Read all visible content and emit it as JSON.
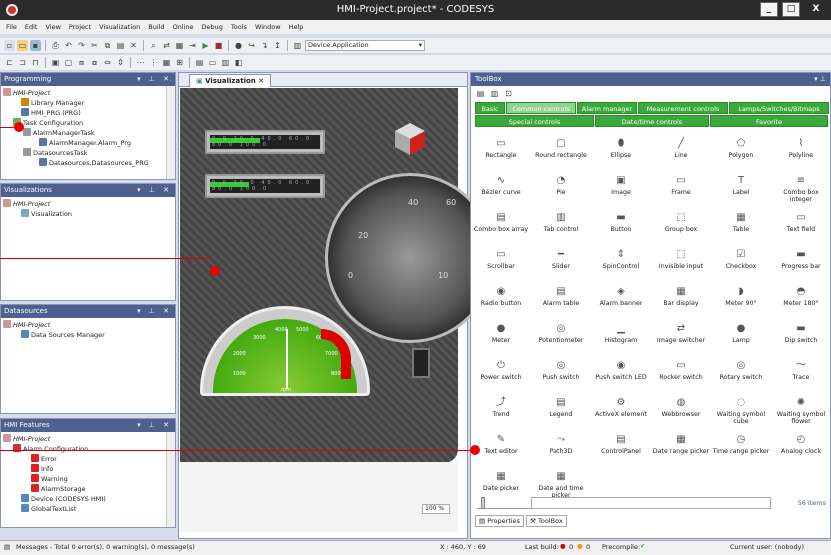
{
  "window": {
    "title": "HMI-Project.project* - CODESYS",
    "min": "_",
    "max": "□",
    "close": "X"
  },
  "menu": [
    "File",
    "Edit",
    "View",
    "Project",
    "Visualization",
    "Build",
    "Online",
    "Debug",
    "Tools",
    "Window",
    "Help"
  ],
  "toolbar": {
    "device": "Device.Application"
  },
  "programming": {
    "title": "Programming",
    "items": [
      "HMI-Project",
      "Library Manager",
      "HMI_PRG (PRG)",
      "Task Configuration",
      "AlarmManagerTask",
      "AlarmManager.Alarm_Prg",
      "DatasourcesTask",
      "Datasources.Datasources_PRG"
    ]
  },
  "visualizations": {
    "title": "Visualizations",
    "items": [
      "HMI-Project",
      "Visualization"
    ]
  },
  "datasources": {
    "title": "Datasources",
    "items": [
      "HMI-Project",
      "Data Sources Manager"
    ]
  },
  "hmi_features": {
    "title": "HMI Features",
    "items": [
      "HMI-Project",
      "Alarm Configuration",
      "Error",
      "Info",
      "Warning",
      "AlarmStorage",
      "Device (CODESYS HMI)",
      "GlobalTextList"
    ]
  },
  "editor": {
    "tab": "Visualization",
    "zoom": "100 %",
    "meter1_labels": "0.0  20.0  40.0  60.0  80.0  100.0",
    "meter2_labels": "0.0  20.0  40.0  60.0  80.0  100.0",
    "dial_labels": [
      "20",
      "40",
      "60",
      "0",
      "10"
    ],
    "gauge_labels": [
      "1000",
      "2000",
      "3000",
      "4000",
      "5000",
      "6000",
      "7000",
      "8000"
    ],
    "gauge_unit": "rpm"
  },
  "toolbox": {
    "title": "ToolBox",
    "categories_row1": [
      "Basic",
      "Common controls",
      "Alarm manager",
      "Measurement controls",
      "Lamps/Switches/Bitmaps"
    ],
    "categories_row2": [
      "Special controls",
      "Date/time controls",
      "Favorite"
    ],
    "items": [
      "Rectangle",
      "Round rectangle",
      "Ellipse",
      "Line",
      "Polygon",
      "Polyline",
      "Bézier curve",
      "Pie",
      "Image",
      "Frame",
      "Label",
      "Combo box integer",
      "Combo box array",
      "Tab control",
      "Button",
      "Group box",
      "Table",
      "Text field",
      "Scrollbar",
      "Slider",
      "SpinControl",
      "Invisible input",
      "Checkbox",
      "Progress bar",
      "Radio button",
      "Alarm table",
      "Alarm banner",
      "Bar display",
      "Meter 90°",
      "Meter 180°",
      "Meter",
      "Potentiometer",
      "Histogram",
      "Image switcher",
      "Lamp",
      "Dip switch",
      "Power switch",
      "Push switch",
      "Push switch LED",
      "Rocker switch",
      "Rotary switch",
      "Trace",
      "Trend",
      "Legend",
      "ActiveX element",
      "Webbrowser",
      "Waiting symbol cube",
      "Waiting symbol flower",
      "Text editor",
      "Path3D",
      "ControlPanel",
      "Date range picker",
      "Time range picker",
      "Analog clock",
      "Date picker",
      "Date and time picker"
    ],
    "count": "56 items",
    "bottom_tabs": [
      "Properties",
      "ToolBox"
    ]
  },
  "status": {
    "messages": "Messages - Total 0 error(s), 0 warning(s), 0 message(s)",
    "coords": "X : 460, Y : 69",
    "last_build": "Last build:",
    "errors": "0",
    "warnings": "0",
    "precompile": "Precompile:",
    "user": "Current user: (nobody)"
  }
}
